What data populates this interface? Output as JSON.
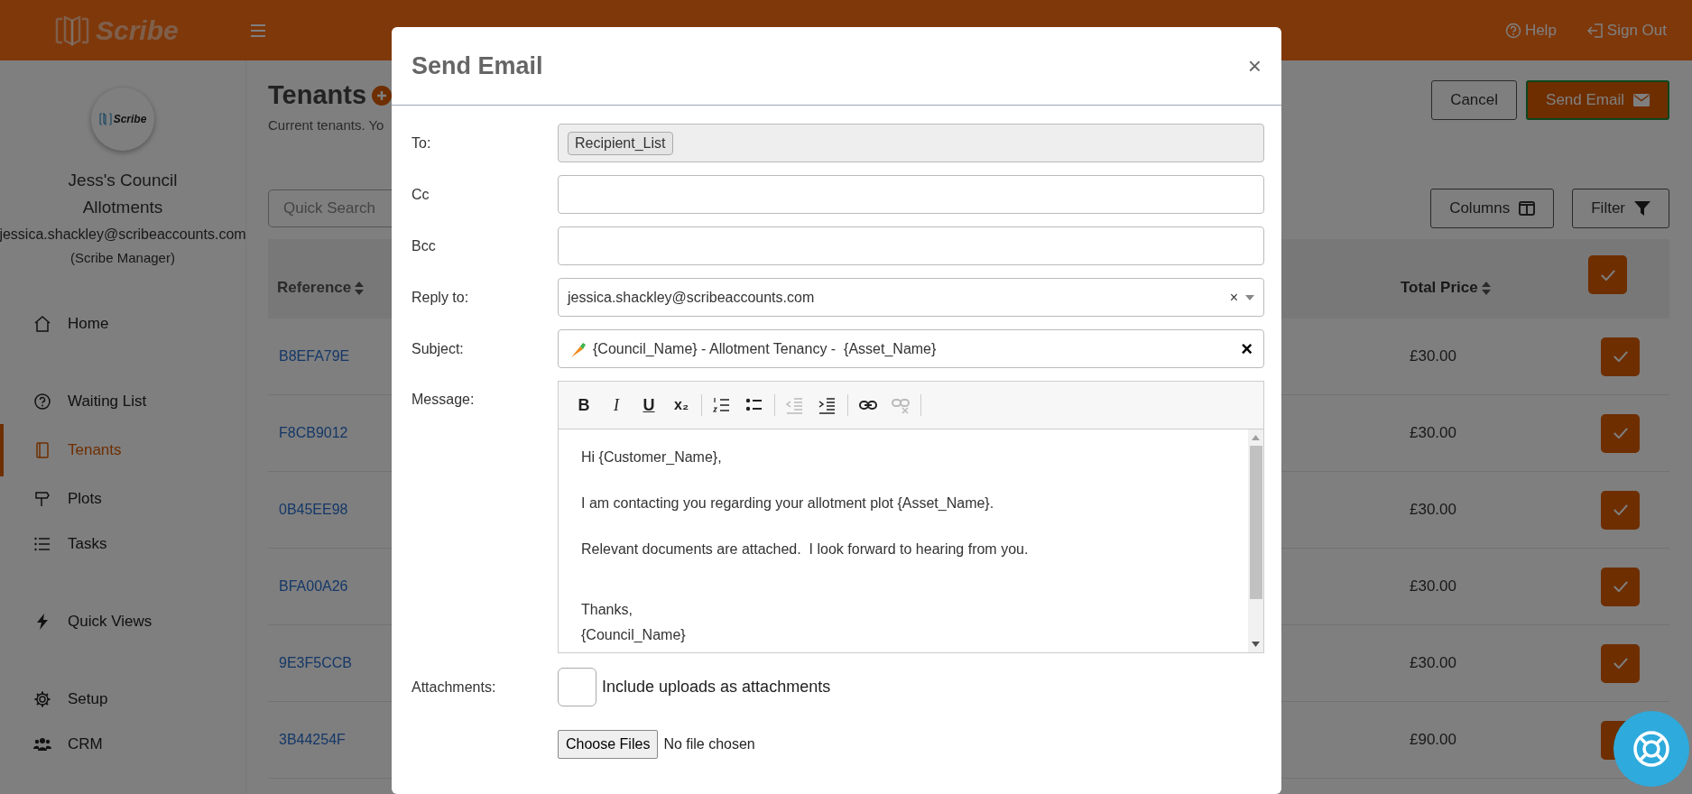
{
  "header": {
    "logo": "Scribe",
    "help": "Help",
    "sign_out": "Sign Out"
  },
  "sidebar": {
    "logo": "Scribe",
    "org": "Jess's Council",
    "org_sub": "Allotments",
    "email": "jessica.shackley@scribeaccounts.com",
    "role": "(Scribe Manager)",
    "items": [
      {
        "label": "Home",
        "selected": false
      },
      {
        "label": "Waiting List",
        "selected": false
      },
      {
        "label": "Tenants",
        "selected": true
      },
      {
        "label": "Plots",
        "selected": false
      },
      {
        "label": "Tasks",
        "selected": false
      },
      {
        "label": "Quick Views",
        "selected": false
      },
      {
        "label": "Setup",
        "selected": false
      },
      {
        "label": "CRM",
        "selected": false
      }
    ]
  },
  "page": {
    "title": "Tenants",
    "subtitle": "Current tenants. Yo",
    "cancel": "Cancel",
    "send": "Send Email",
    "search_placeholder": "Quick Search",
    "columns": "Columns",
    "filter": "Filter"
  },
  "table": {
    "columns": [
      "Reference",
      "Total Price"
    ],
    "all_checked": true,
    "rows": [
      {
        "reference": "B8EFA79E",
        "price": "£30.00",
        "checked": true
      },
      {
        "reference": "F8CB9012",
        "price": "£30.00",
        "checked": true
      },
      {
        "reference": "0B45EE98",
        "price": "£30.00",
        "checked": true
      },
      {
        "reference": "BFA00A26",
        "price": "£30.00",
        "checked": true
      },
      {
        "reference": "9E3F5CCB",
        "price": "£30.00",
        "checked": true
      },
      {
        "reference": "3B44254F",
        "price": "£90.00",
        "checked": true
      }
    ]
  },
  "modal": {
    "title": "Send Email",
    "close": "×",
    "fields": [
      {
        "kind": "tags",
        "label": "To:",
        "tags": [
          "Recipient_List"
        ]
      },
      {
        "kind": "text",
        "label": "Cc"
      },
      {
        "kind": "text",
        "label": "Bcc"
      },
      {
        "kind": "select",
        "label": "Reply to:",
        "value": "jessica.shackley@scribeaccounts.com",
        "clear": "×"
      },
      {
        "kind": "subject",
        "label": "Subject:",
        "value": "{Council_Name} - Allotment Tenancy -  {Asset_Name}",
        "clear": "×"
      }
    ],
    "message": {
      "label": "Message:",
      "tools": [
        {
          "kind": "bold",
          "label": "B",
          "disabled": false
        },
        {
          "kind": "italic",
          "label": "I",
          "disabled": false
        },
        {
          "kind": "underline",
          "label": "U",
          "disabled": false
        },
        {
          "kind": "subscript",
          "label": "x₂",
          "disabled": false
        },
        {
          "kind": "separator"
        },
        {
          "kind": "ordered-list",
          "disabled": false
        },
        {
          "kind": "bullet-list",
          "disabled": false
        },
        {
          "kind": "separator"
        },
        {
          "kind": "outdent",
          "disabled": true
        },
        {
          "kind": "indent",
          "disabled": false
        },
        {
          "kind": "separator"
        },
        {
          "kind": "link",
          "disabled": false
        },
        {
          "kind": "unlink",
          "disabled": true
        },
        {
          "kind": "separator"
        }
      ],
      "paragraphs": [
        [
          "Hi {Customer_Name},"
        ],
        [
          "I am contacting you regarding your allotment plot {Asset_Name}."
        ],
        [
          "Relevant documents are attached.  I look forward to hearing from you."
        ],
        [
          "Thanks,",
          "{Council_Name}"
        ]
      ]
    },
    "attachments": {
      "label": "Attachments:",
      "checked": false,
      "text": "Include uploads as attachments",
      "file_button": "Choose Files",
      "file_status": "No file chosen"
    }
  }
}
